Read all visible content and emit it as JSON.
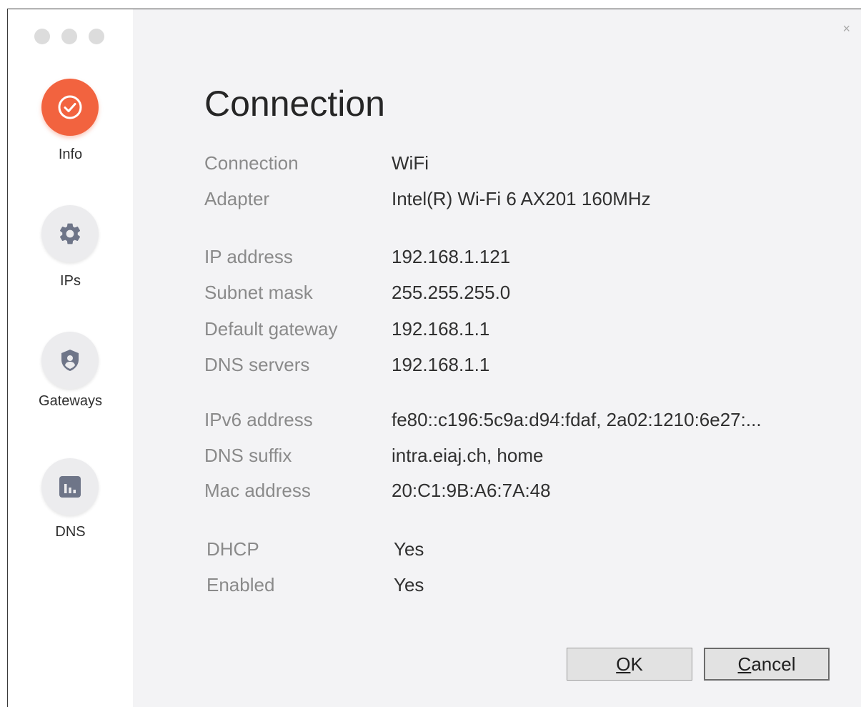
{
  "window": {
    "close_label": "×"
  },
  "sidebar": {
    "items": [
      {
        "label": "Info",
        "icon": "check-circle-icon",
        "active": true
      },
      {
        "label": "IPs",
        "icon": "gear-icon",
        "active": false
      },
      {
        "label": "Gateways",
        "icon": "shield-user-icon",
        "active": false
      },
      {
        "label": "DNS",
        "icon": "bar-chart-icon",
        "active": false
      }
    ]
  },
  "main": {
    "title": "Connection",
    "groups": [
      [
        {
          "label": "Connection",
          "value": "WiFi"
        },
        {
          "label": "Adapter",
          "value": "Intel(R) Wi-Fi 6 AX201 160MHz"
        }
      ],
      [
        {
          "label": "IP address",
          "value": "192.168.1.121"
        },
        {
          "label": "Subnet mask",
          "value": "255.255.255.0"
        },
        {
          "label": "Default gateway",
          "value": "192.168.1.1"
        },
        {
          "label": "DNS servers",
          "value": "192.168.1.1"
        }
      ],
      [
        {
          "label": "IPv6 address",
          "value": "fe80::c196:5c9a:d94:fdaf, 2a02:1210:6e27:..."
        },
        {
          "label": "DNS suffix",
          "value": "intra.eiaj.ch, home"
        },
        {
          "label": "Mac address",
          "value": "20:C1:9B:A6:7A:48"
        }
      ],
      [
        {
          "label": "DHCP",
          "value": "Yes"
        },
        {
          "label": "Enabled",
          "value": "Yes"
        }
      ]
    ]
  },
  "buttons": {
    "ok": {
      "mnemonic": "O",
      "rest": "K"
    },
    "cancel": {
      "mnemonic": "C",
      "rest": "ancel"
    }
  },
  "colors": {
    "accent": "#f2633f",
    "icon_inactive": "#6e7588"
  }
}
